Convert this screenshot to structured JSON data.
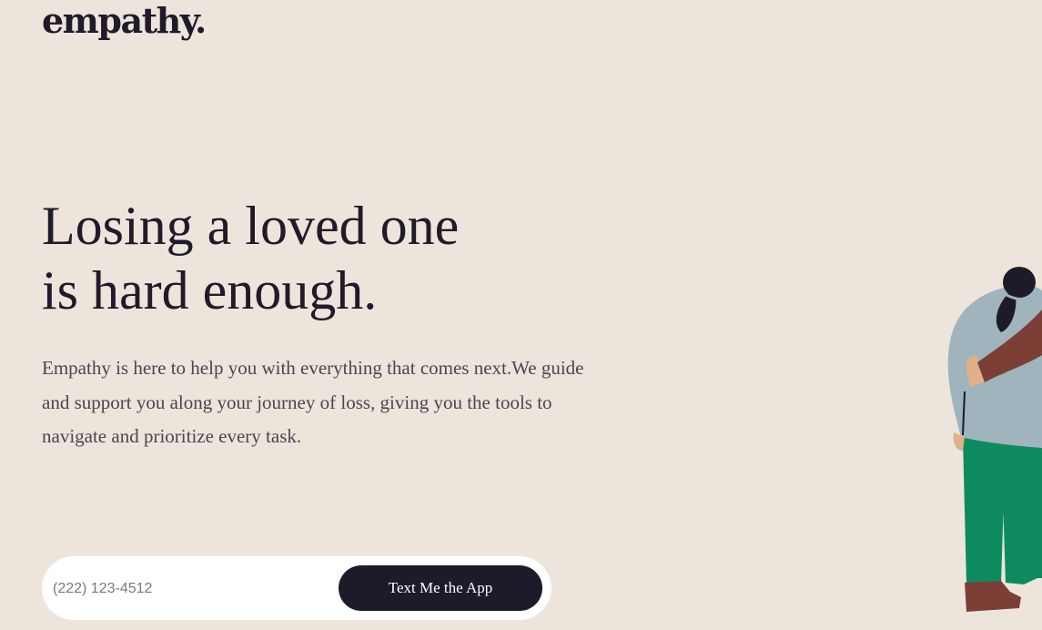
{
  "brand": {
    "logo_text": "empathy."
  },
  "hero": {
    "headline_line1": "Losing a loved one",
    "headline_line2": "is hard enough.",
    "description": "Empathy is here to help you with everything that comes next.We guide and support you along your journey of loss, giving you the tools to navigate and prioritize every task."
  },
  "signup": {
    "phone_placeholder": "(222) 123-4512",
    "cta_label": "Text Me the App"
  },
  "colors": {
    "background": "#ede5dc",
    "ink": "#1f1b2a",
    "button": "#1e1a2a",
    "figure_sweater": "#9fb4bc",
    "figure_pants": "#0e8a5f",
    "figure_arm": "#7b3f36",
    "figure_hair": "#1c1b27"
  },
  "illustration": {
    "icon": "hugging-people-illustration"
  }
}
